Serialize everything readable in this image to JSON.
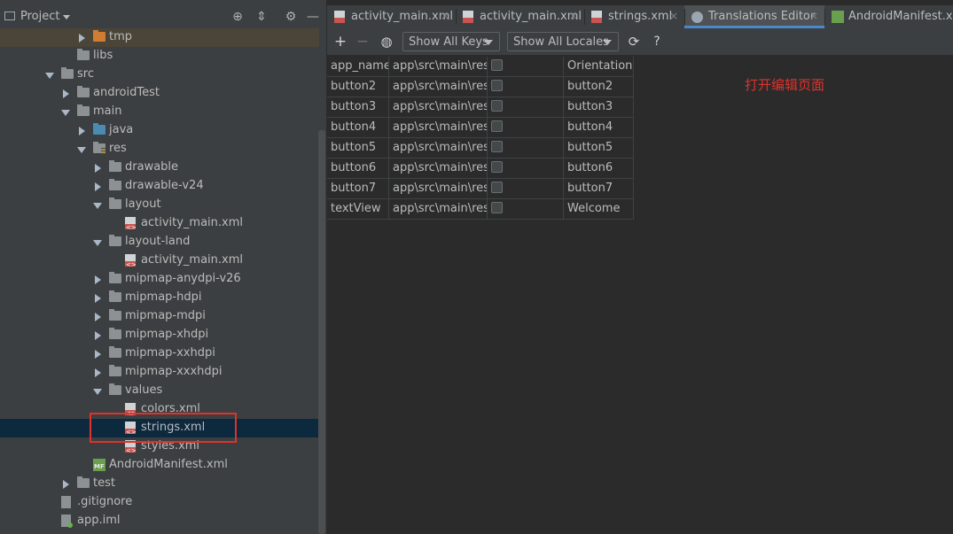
{
  "project_panel": {
    "title": "Project",
    "tree": [
      {
        "label": "tmp",
        "icon": "folder-orange",
        "arrow": "right",
        "level": 3
      },
      {
        "label": "libs",
        "icon": "folder",
        "arrow": "none",
        "level": 2
      },
      {
        "label": "src",
        "icon": "folder",
        "arrow": "down",
        "level": 1
      },
      {
        "label": "androidTest",
        "icon": "folder",
        "arrow": "right",
        "level": 2
      },
      {
        "label": "main",
        "icon": "folder",
        "arrow": "down",
        "level": 2
      },
      {
        "label": "java",
        "icon": "folder-blue",
        "arrow": "right",
        "level": 3
      },
      {
        "label": "res",
        "icon": "folder-res",
        "arrow": "down",
        "level": 3
      },
      {
        "label": "drawable",
        "icon": "folder",
        "arrow": "right",
        "level": 4
      },
      {
        "label": "drawable-v24",
        "icon": "folder",
        "arrow": "right",
        "level": 4
      },
      {
        "label": "layout",
        "icon": "folder",
        "arrow": "down",
        "level": 4
      },
      {
        "label": "activity_main.xml",
        "icon": "xml",
        "arrow": "none",
        "level": 5
      },
      {
        "label": "layout-land",
        "icon": "folder",
        "arrow": "down",
        "level": 4
      },
      {
        "label": "activity_main.xml",
        "icon": "xml",
        "arrow": "none",
        "level": 5
      },
      {
        "label": "mipmap-anydpi-v26",
        "icon": "folder",
        "arrow": "right",
        "level": 4
      },
      {
        "label": "mipmap-hdpi",
        "icon": "folder",
        "arrow": "right",
        "level": 4
      },
      {
        "label": "mipmap-mdpi",
        "icon": "folder",
        "arrow": "right",
        "level": 4
      },
      {
        "label": "mipmap-xhdpi",
        "icon": "folder",
        "arrow": "right",
        "level": 4
      },
      {
        "label": "mipmap-xxhdpi",
        "icon": "folder",
        "arrow": "right",
        "level": 4
      },
      {
        "label": "mipmap-xxxhdpi",
        "icon": "folder",
        "arrow": "right",
        "level": 4
      },
      {
        "label": "values",
        "icon": "folder",
        "arrow": "down",
        "level": 4
      },
      {
        "label": "colors.xml",
        "icon": "xml",
        "arrow": "none",
        "level": 5
      },
      {
        "label": "strings.xml",
        "icon": "xml",
        "arrow": "none",
        "level": 5,
        "selected": true
      },
      {
        "label": "styles.xml",
        "icon": "xml",
        "arrow": "none",
        "level": 5
      },
      {
        "label": "AndroidManifest.xml",
        "icon": "manifest",
        "arrow": "none",
        "level": 3
      },
      {
        "label": "test",
        "icon": "folder",
        "arrow": "right",
        "level": 2
      },
      {
        "label": ".gitignore",
        "icon": "file",
        "arrow": "none",
        "level": 1
      },
      {
        "label": "app.iml",
        "icon": "iml",
        "arrow": "none",
        "level": 1
      }
    ]
  },
  "tabs": [
    {
      "label": "activity_main.xml",
      "icon": "xml",
      "active": false
    },
    {
      "label": "activity_main.xml",
      "icon": "xml",
      "active": false
    },
    {
      "label": "strings.xml",
      "icon": "xml",
      "active": false
    },
    {
      "label": "Translations Editor",
      "icon": "globe",
      "active": true
    },
    {
      "label": "AndroidManifest.xml",
      "icon": "manifest",
      "active": false
    }
  ],
  "toolbar": {
    "add": "+",
    "remove": "−",
    "keys_filter": "Show All Keys",
    "locales_filter": "Show All Locales",
    "help": "?"
  },
  "translations": {
    "rows": [
      {
        "key": "app_name",
        "resource_folder": "app\\src\\main\\res",
        "untranslatable": false,
        "default_value": "Orientation"
      },
      {
        "key": "button2",
        "resource_folder": "app\\src\\main\\res",
        "untranslatable": false,
        "default_value": "button2"
      },
      {
        "key": "button3",
        "resource_folder": "app\\src\\main\\res",
        "untranslatable": false,
        "default_value": "button3"
      },
      {
        "key": "button4",
        "resource_folder": "app\\src\\main\\res",
        "untranslatable": false,
        "default_value": "button4"
      },
      {
        "key": "button5",
        "resource_folder": "app\\src\\main\\res",
        "untranslatable": false,
        "default_value": "button5"
      },
      {
        "key": "button6",
        "resource_folder": "app\\src\\main\\res",
        "untranslatable": false,
        "default_value": "button6"
      },
      {
        "key": "button7",
        "resource_folder": "app\\src\\main\\res",
        "untranslatable": false,
        "default_value": "button7"
      },
      {
        "key": "textView",
        "resource_folder": "app\\src\\main\\res",
        "untranslatable": false,
        "default_value": "Welcome"
      }
    ]
  },
  "annotation": "打开编辑页面",
  "colors": {
    "highlight_box": "#e0312c",
    "selection": "#0d293e",
    "active_tab_underline": "#4a88c7"
  }
}
